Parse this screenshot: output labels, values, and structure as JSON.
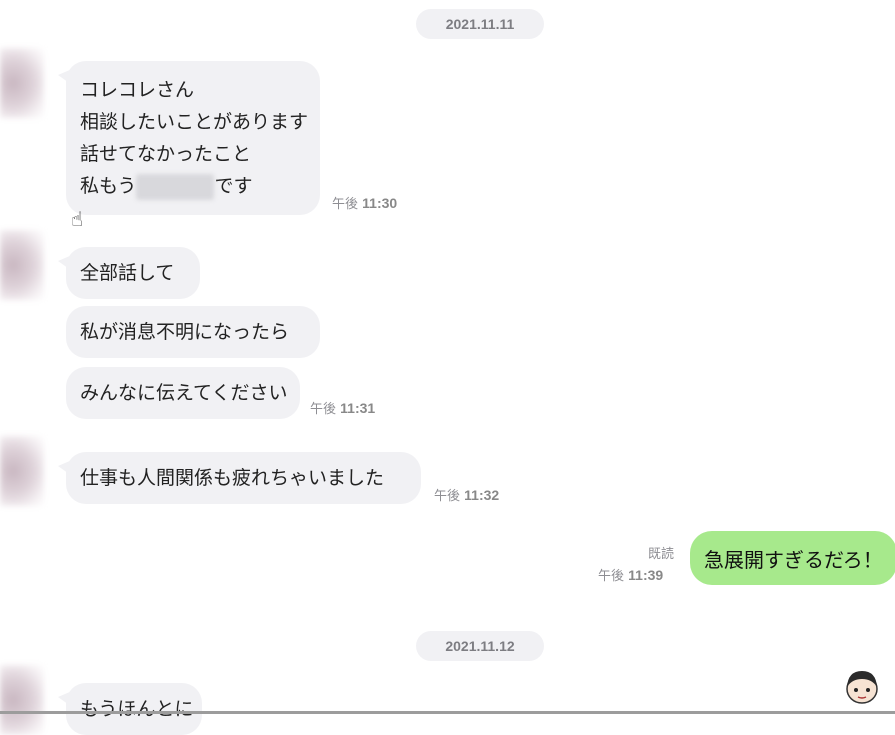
{
  "dates": [
    "2021.11.11",
    "2021.11.12"
  ],
  "messages": [
    {
      "lines": [
        "コレコレさん",
        "相談したいことがあります",
        "話せてなかったこと"
      ],
      "last_line_before": "私もう",
      "last_line_after": "です",
      "time_prefix": "午後",
      "time": "11:30"
    },
    {
      "text": "全部話して"
    },
    {
      "text": "私が消息不明になったら"
    },
    {
      "text": "みんなに伝えてください",
      "time_prefix": "午後",
      "time": "11:31"
    },
    {
      "text": "仕事も人間関係も疲れちゃいました",
      "time_prefix": "午後",
      "time": "11:32"
    },
    {
      "text": "もうほんとに"
    }
  ],
  "my_message": {
    "text": "急展開すぎるだろ！",
    "read": "既読",
    "time_prefix": "午後",
    "time": "11:39"
  },
  "colors": {
    "incoming_bubble": "#f1f1f4",
    "outgoing_bubble": "#a7e98c",
    "date_pill": "#f1f1f4"
  },
  "icons": {
    "cursor": "hand-pointer-icon",
    "avatar": "chibi-avatar-icon"
  }
}
